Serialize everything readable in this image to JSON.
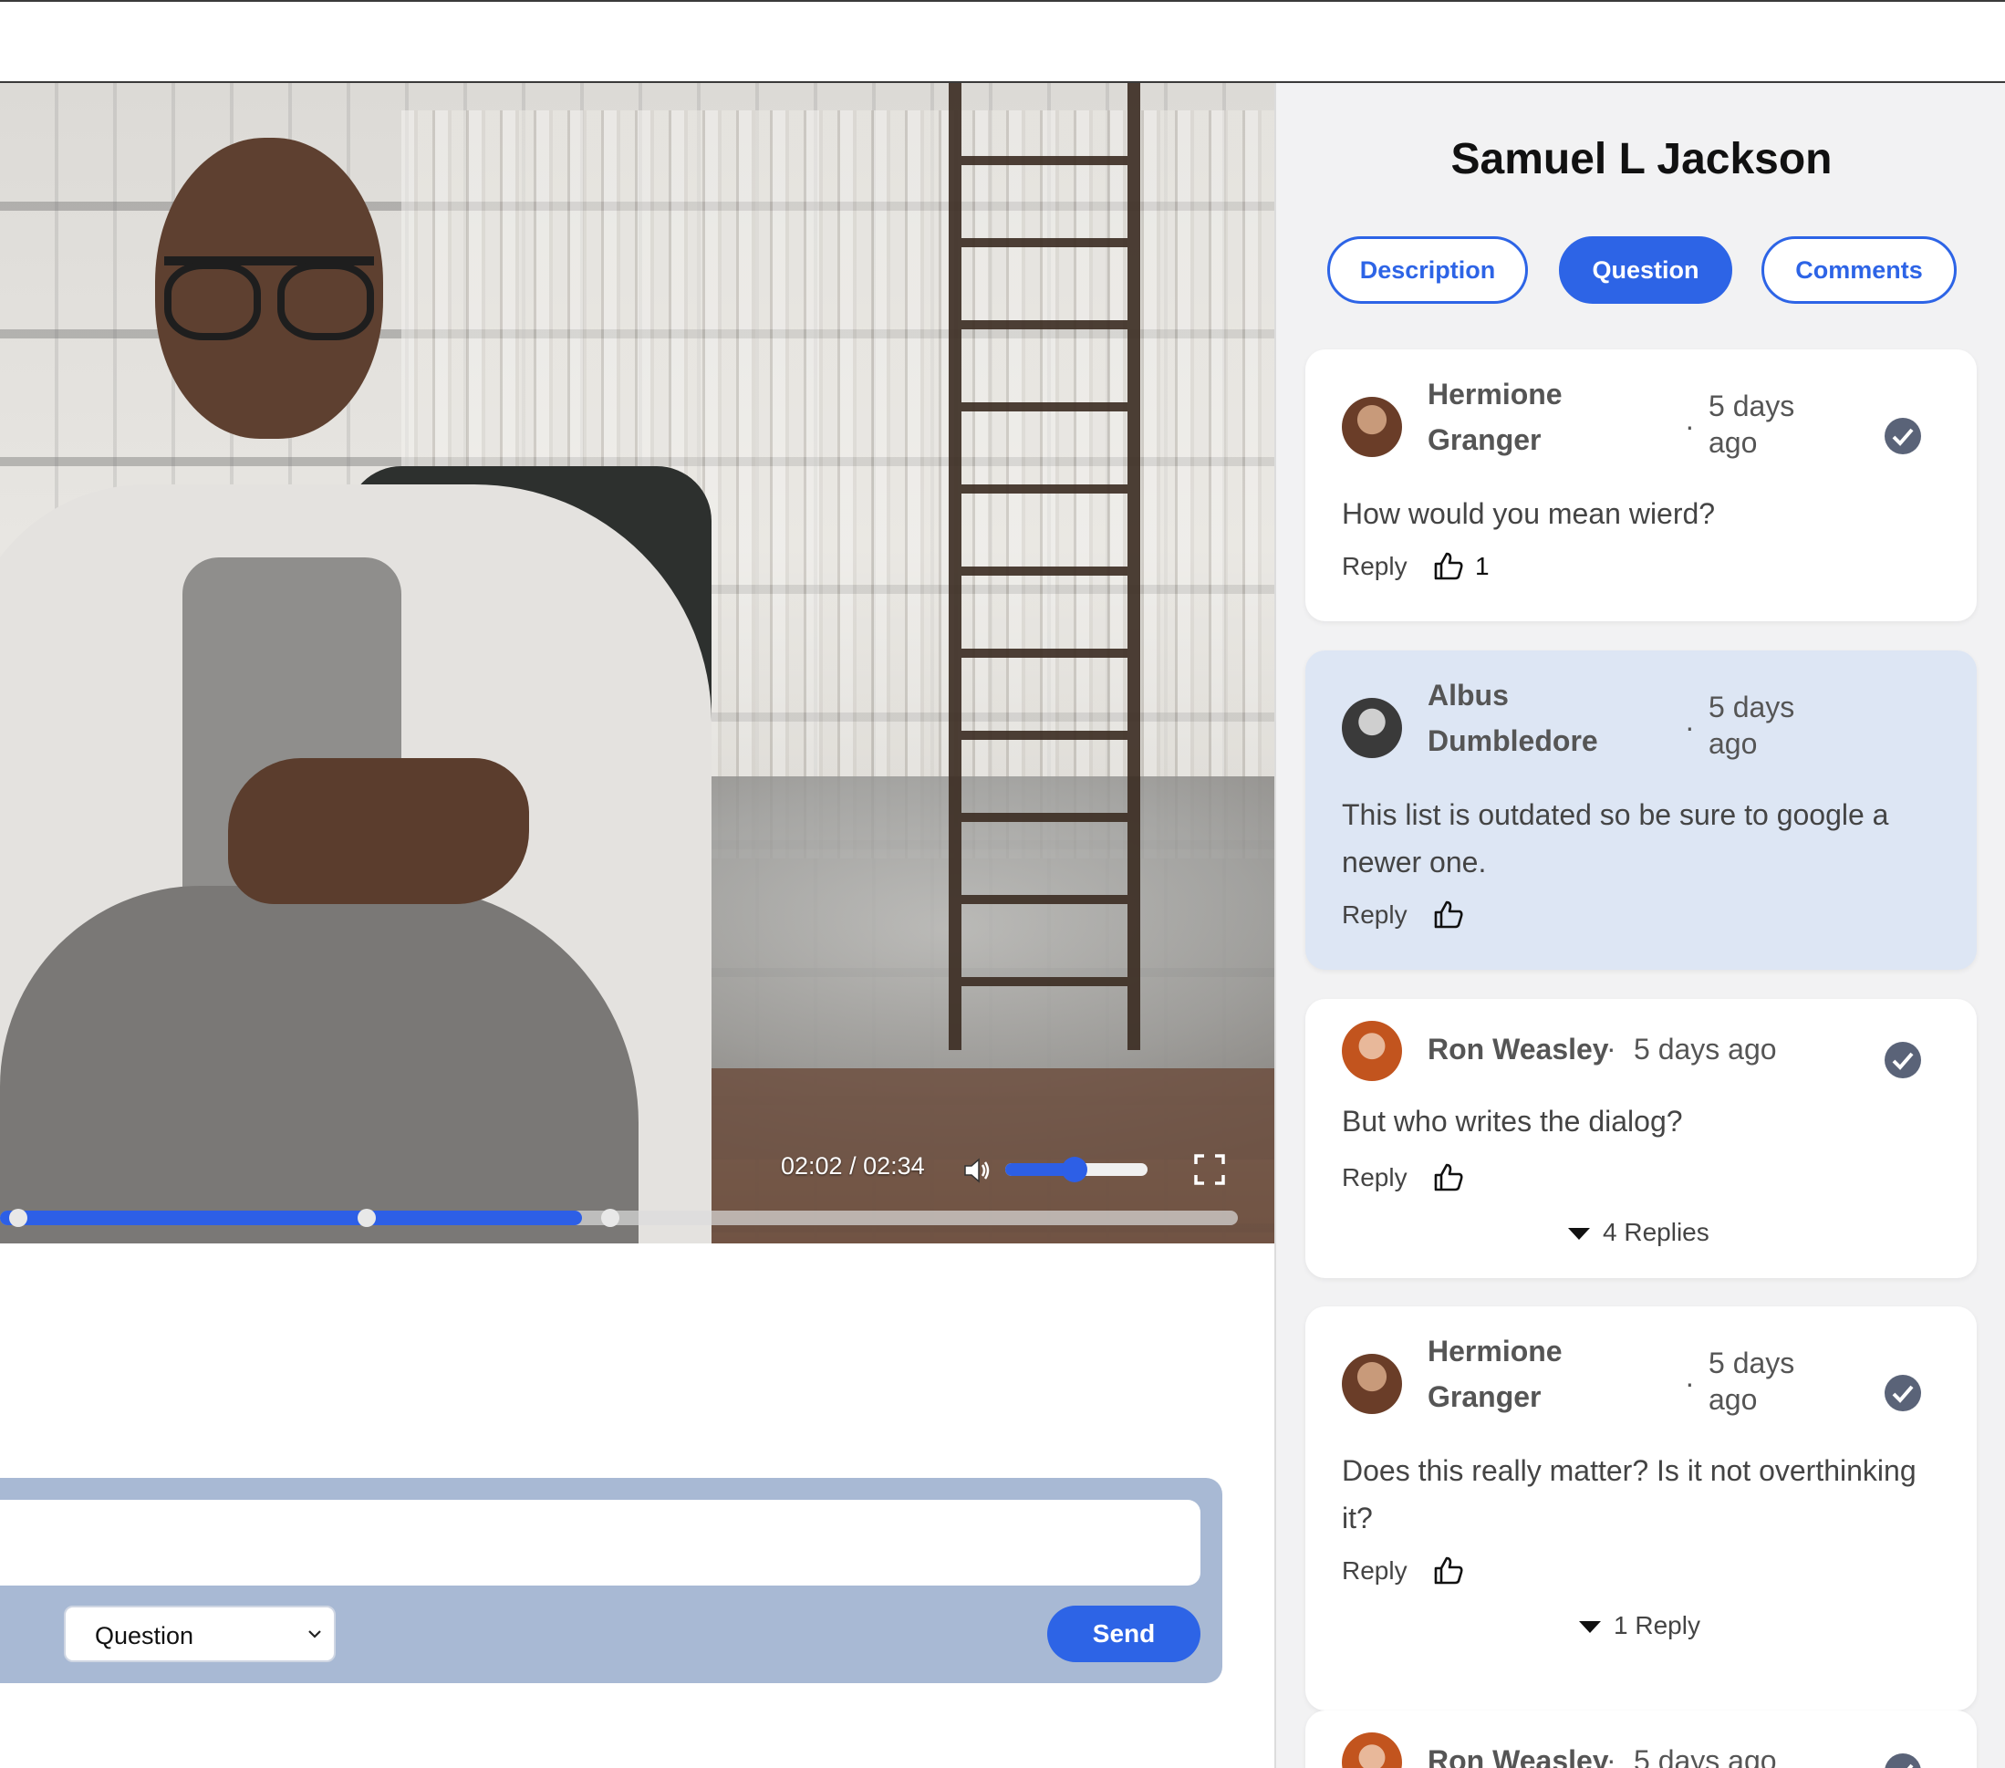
{
  "player": {
    "time_display": "02:02 / 02:34",
    "progress_fraction": 0.47,
    "volume_fraction": 0.42,
    "accent_color": "#2d5fe6"
  },
  "composer": {
    "input_value": "",
    "type_selected": "Question",
    "send_label": "Send"
  },
  "sidebar": {
    "title": "Samuel L Jackson",
    "tabs": [
      {
        "label": "Description",
        "active": false
      },
      {
        "label": "Question",
        "active": true
      },
      {
        "label": "Comments",
        "active": false
      }
    ],
    "comments": [
      {
        "author_line1": "Hermione",
        "author_line2": "Granger",
        "time_line1": "5 days",
        "time_line2": "ago",
        "text": "How would you mean wierd?",
        "reply_label": "Reply",
        "likes": "1",
        "answered": true
      },
      {
        "author_line1": "Albus",
        "author_line2": "Dumbledore",
        "time_line1": "5 days",
        "time_line2": "ago",
        "text": "This list is outdated so be sure to google a newer one.",
        "reply_label": "Reply",
        "answered": false
      },
      {
        "author": "Ron Weasley",
        "time": "5 days ago",
        "text": "But who writes the dialog?",
        "reply_label": "Reply",
        "replies_label": "4 Replies",
        "answered": true
      },
      {
        "author_line1": "Hermione",
        "author_line2": "Granger",
        "time_line1": "5 days",
        "time_line2": "ago",
        "text": "Does this really matter? Is it not overthinking it?",
        "reply_label": "Reply",
        "replies_label": "1 Reply",
        "answered": true
      },
      {
        "author": "Ron Weasley",
        "time": "5 days ago"
      }
    ],
    "dot_separator": "·"
  },
  "icons": {
    "volume": "speaker-icon",
    "fullscreen": "fullscreen-icon",
    "check": "check-circle-icon",
    "like": "thumbs-up-icon",
    "chevron": "chevron-down-icon"
  }
}
